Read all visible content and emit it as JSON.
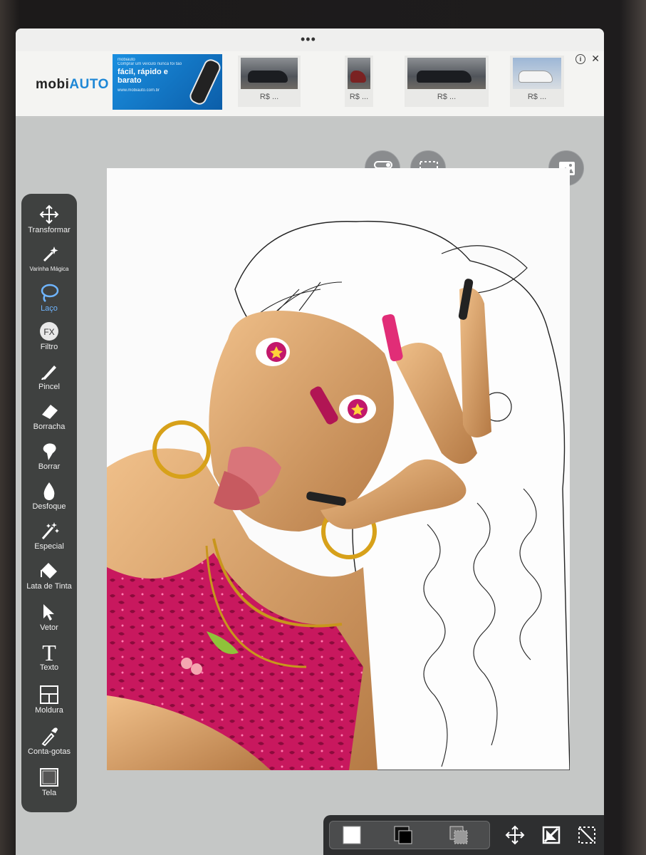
{
  "ad": {
    "logo_main": "mobi",
    "logo_accent": "AUTO",
    "banner_small": "mobiauto",
    "banner_tag": "Comprar um veículo nunca foi tão",
    "banner_big": "fácil, rápido e barato",
    "banner_url": "www.mobiauto.com.br",
    "prices": [
      "R$ ...",
      "R$ ...",
      "R$ ...",
      "R$ ..."
    ],
    "info_label": "i",
    "close_label": "✕"
  },
  "topbar": {
    "handle": "•••"
  },
  "tools": [
    {
      "label": "Transformar",
      "icon": "move-arrows-icon"
    },
    {
      "label": "Varinha Mágica",
      "icon": "magic-wand-icon"
    },
    {
      "label": "Laço",
      "icon": "lasso-icon",
      "active": true
    },
    {
      "label": "Filtro",
      "icon": "fx-icon",
      "badge": "FX"
    },
    {
      "label": "Pincel",
      "icon": "brush-icon"
    },
    {
      "label": "Borracha",
      "icon": "eraser-icon"
    },
    {
      "label": "Borrar",
      "icon": "smudge-icon"
    },
    {
      "label": "Desfoque",
      "icon": "blur-drop-icon"
    },
    {
      "label": "Especial",
      "icon": "special-sparkle-icon"
    },
    {
      "label": "Lata de Tinta",
      "icon": "paint-bucket-icon"
    },
    {
      "label": "Vetor",
      "icon": "vector-arrow-icon"
    },
    {
      "label": "Texto",
      "icon": "text-icon",
      "glyph": "T"
    },
    {
      "label": "Moldura",
      "icon": "frame-icon"
    },
    {
      "label": "Conta-gotas",
      "icon": "eyedropper-icon"
    },
    {
      "label": "Tela",
      "icon": "canvas-icon"
    }
  ],
  "colors": {
    "accent": "#6fb5ff",
    "toolbar": "#3f4140",
    "lingerie": "#c8185e",
    "skin": "#d9a066"
  }
}
